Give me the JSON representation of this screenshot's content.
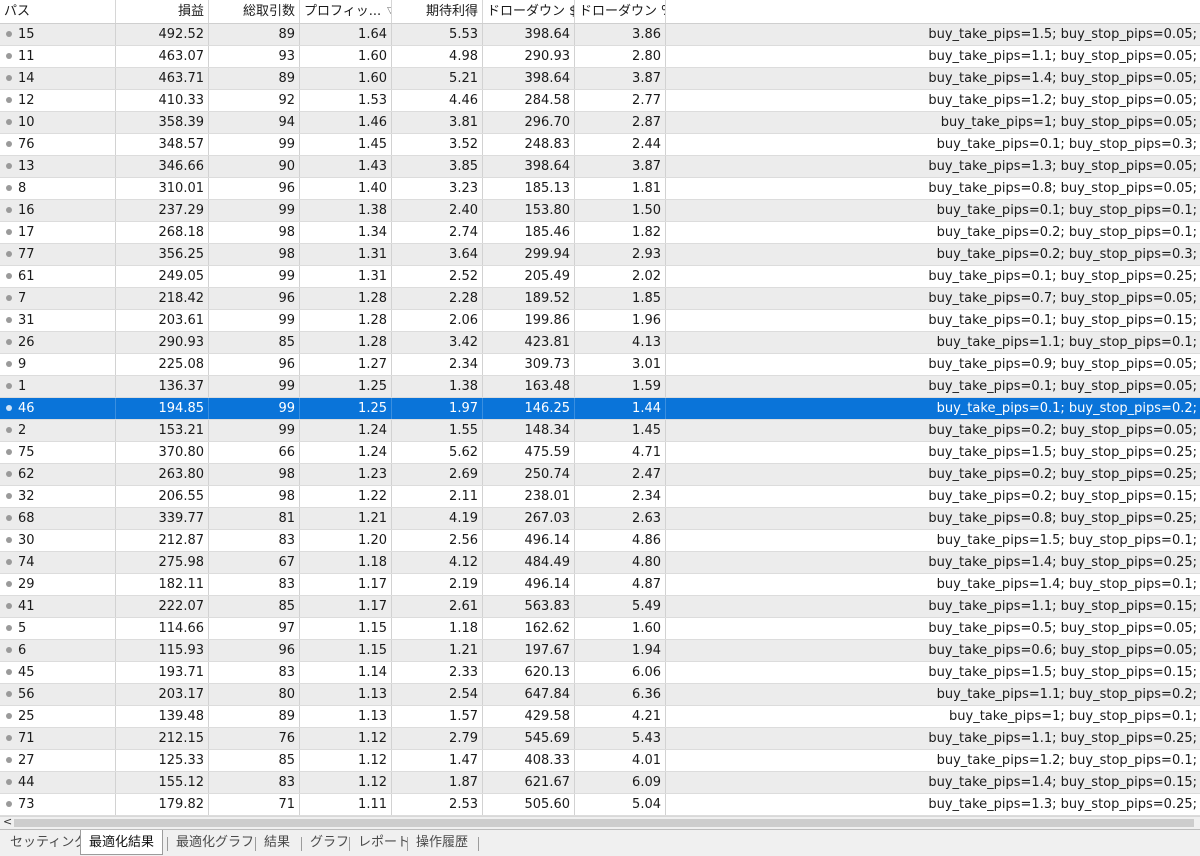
{
  "columns": {
    "pass": "パス",
    "profit": "損益",
    "trades": "総取引数",
    "pf": "プロフィッ...",
    "expected": "期待利得",
    "dd_money": "ドローダウン $",
    "dd_pct": "ドローダウン %"
  },
  "rows": [
    [
      "15",
      "492.52",
      "89",
      "1.64",
      "5.53",
      "398.64",
      "3.86",
      "buy_take_pips=1.5; buy_stop_pips=0.05;"
    ],
    [
      "11",
      "463.07",
      "93",
      "1.60",
      "4.98",
      "290.93",
      "2.80",
      "buy_take_pips=1.1; buy_stop_pips=0.05;"
    ],
    [
      "14",
      "463.71",
      "89",
      "1.60",
      "5.21",
      "398.64",
      "3.87",
      "buy_take_pips=1.4; buy_stop_pips=0.05;"
    ],
    [
      "12",
      "410.33",
      "92",
      "1.53",
      "4.46",
      "284.58",
      "2.77",
      "buy_take_pips=1.2; buy_stop_pips=0.05;"
    ],
    [
      "10",
      "358.39",
      "94",
      "1.46",
      "3.81",
      "296.70",
      "2.87",
      "buy_take_pips=1; buy_stop_pips=0.05;"
    ],
    [
      "76",
      "348.57",
      "99",
      "1.45",
      "3.52",
      "248.83",
      "2.44",
      "buy_take_pips=0.1; buy_stop_pips=0.3;"
    ],
    [
      "13",
      "346.66",
      "90",
      "1.43",
      "3.85",
      "398.64",
      "3.87",
      "buy_take_pips=1.3; buy_stop_pips=0.05;"
    ],
    [
      "8",
      "310.01",
      "96",
      "1.40",
      "3.23",
      "185.13",
      "1.81",
      "buy_take_pips=0.8; buy_stop_pips=0.05;"
    ],
    [
      "16",
      "237.29",
      "99",
      "1.38",
      "2.40",
      "153.80",
      "1.50",
      "buy_take_pips=0.1; buy_stop_pips=0.1;"
    ],
    [
      "17",
      "268.18",
      "98",
      "1.34",
      "2.74",
      "185.46",
      "1.82",
      "buy_take_pips=0.2; buy_stop_pips=0.1;"
    ],
    [
      "77",
      "356.25",
      "98",
      "1.31",
      "3.64",
      "299.94",
      "2.93",
      "buy_take_pips=0.2; buy_stop_pips=0.3;"
    ],
    [
      "61",
      "249.05",
      "99",
      "1.31",
      "2.52",
      "205.49",
      "2.02",
      "buy_take_pips=0.1; buy_stop_pips=0.25;"
    ],
    [
      "7",
      "218.42",
      "96",
      "1.28",
      "2.28",
      "189.52",
      "1.85",
      "buy_take_pips=0.7; buy_stop_pips=0.05;"
    ],
    [
      "31",
      "203.61",
      "99",
      "1.28",
      "2.06",
      "199.86",
      "1.96",
      "buy_take_pips=0.1; buy_stop_pips=0.15;"
    ],
    [
      "26",
      "290.93",
      "85",
      "1.28",
      "3.42",
      "423.81",
      "4.13",
      "buy_take_pips=1.1; buy_stop_pips=0.1;"
    ],
    [
      "9",
      "225.08",
      "96",
      "1.27",
      "2.34",
      "309.73",
      "3.01",
      "buy_take_pips=0.9; buy_stop_pips=0.05;"
    ],
    [
      "1",
      "136.37",
      "99",
      "1.25",
      "1.38",
      "163.48",
      "1.59",
      "buy_take_pips=0.1; buy_stop_pips=0.05;"
    ],
    [
      "46",
      "194.85",
      "99",
      "1.25",
      "1.97",
      "146.25",
      "1.44",
      "buy_take_pips=0.1; buy_stop_pips=0.2;"
    ],
    [
      "2",
      "153.21",
      "99",
      "1.24",
      "1.55",
      "148.34",
      "1.45",
      "buy_take_pips=0.2; buy_stop_pips=0.05;"
    ],
    [
      "75",
      "370.80",
      "66",
      "1.24",
      "5.62",
      "475.59",
      "4.71",
      "buy_take_pips=1.5; buy_stop_pips=0.25;"
    ],
    [
      "62",
      "263.80",
      "98",
      "1.23",
      "2.69",
      "250.74",
      "2.47",
      "buy_take_pips=0.2; buy_stop_pips=0.25;"
    ],
    [
      "32",
      "206.55",
      "98",
      "1.22",
      "2.11",
      "238.01",
      "2.34",
      "buy_take_pips=0.2; buy_stop_pips=0.15;"
    ],
    [
      "68",
      "339.77",
      "81",
      "1.21",
      "4.19",
      "267.03",
      "2.63",
      "buy_take_pips=0.8; buy_stop_pips=0.25;"
    ],
    [
      "30",
      "212.87",
      "83",
      "1.20",
      "2.56",
      "496.14",
      "4.86",
      "buy_take_pips=1.5; buy_stop_pips=0.1;"
    ],
    [
      "74",
      "275.98",
      "67",
      "1.18",
      "4.12",
      "484.49",
      "4.80",
      "buy_take_pips=1.4; buy_stop_pips=0.25;"
    ],
    [
      "29",
      "182.11",
      "83",
      "1.17",
      "2.19",
      "496.14",
      "4.87",
      "buy_take_pips=1.4; buy_stop_pips=0.1;"
    ],
    [
      "41",
      "222.07",
      "85",
      "1.17",
      "2.61",
      "563.83",
      "5.49",
      "buy_take_pips=1.1; buy_stop_pips=0.15;"
    ],
    [
      "5",
      "114.66",
      "97",
      "1.15",
      "1.18",
      "162.62",
      "1.60",
      "buy_take_pips=0.5; buy_stop_pips=0.05;"
    ],
    [
      "6",
      "115.93",
      "96",
      "1.15",
      "1.21",
      "197.67",
      "1.94",
      "buy_take_pips=0.6; buy_stop_pips=0.05;"
    ],
    [
      "45",
      "193.71",
      "83",
      "1.14",
      "2.33",
      "620.13",
      "6.06",
      "buy_take_pips=1.5; buy_stop_pips=0.15;"
    ],
    [
      "56",
      "203.17",
      "80",
      "1.13",
      "2.54",
      "647.84",
      "6.36",
      "buy_take_pips=1.1; buy_stop_pips=0.2;"
    ],
    [
      "25",
      "139.48",
      "89",
      "1.13",
      "1.57",
      "429.58",
      "4.21",
      "buy_take_pips=1; buy_stop_pips=0.1;"
    ],
    [
      "71",
      "212.15",
      "76",
      "1.12",
      "2.79",
      "545.69",
      "5.43",
      "buy_take_pips=1.1; buy_stop_pips=0.25;"
    ],
    [
      "27",
      "125.33",
      "85",
      "1.12",
      "1.47",
      "408.33",
      "4.01",
      "buy_take_pips=1.2; buy_stop_pips=0.1;"
    ],
    [
      "44",
      "155.12",
      "83",
      "1.12",
      "1.87",
      "621.67",
      "6.09",
      "buy_take_pips=1.4; buy_stop_pips=0.15;"
    ],
    [
      "73",
      "179.82",
      "71",
      "1.11",
      "2.53",
      "505.60",
      "5.04",
      "buy_take_pips=1.3; buy_stop_pips=0.25;"
    ]
  ],
  "selected_pass": "46",
  "tabs": [
    "セッティング",
    "最適化結果",
    "最適化グラフ",
    "結果",
    "グラフ",
    "レポート",
    "操作履歴"
  ],
  "active_tab": "最適化結果",
  "colors": {
    "selection": "#0a74d9",
    "alt_row": "#ececec"
  },
  "icons": {
    "row_marker": "dot-icon",
    "sort_indicator": "sort-descending-icon",
    "scroll_left": "scroll-left-arrow-icon"
  },
  "scroll_arrow": "<"
}
